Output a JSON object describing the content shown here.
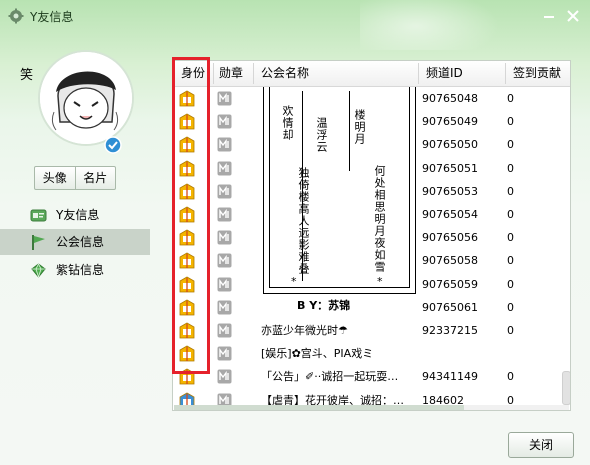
{
  "window": {
    "title": "Y友信息"
  },
  "profile": {
    "avatar_label": "笑",
    "buttons": [
      "头像",
      "名片"
    ]
  },
  "sidebar": {
    "items": [
      {
        "label": "Y友信息",
        "icon": "id-card-icon"
      },
      {
        "label": "公会信息",
        "icon": "flag-icon",
        "active": true
      },
      {
        "label": "紫钻信息",
        "icon": "diamond-icon"
      }
    ]
  },
  "table": {
    "columns": [
      "身份",
      "勋章",
      "公会名称",
      "频道ID",
      "签到贡献"
    ],
    "rows": [
      {
        "channel_id": "90765048",
        "contribution": "0"
      },
      {
        "channel_id": "90765049",
        "contribution": "0"
      },
      {
        "channel_id": "90765050",
        "contribution": "0"
      },
      {
        "channel_id": "90765051",
        "contribution": "0"
      },
      {
        "channel_id": "90765053",
        "contribution": "0"
      },
      {
        "channel_id": "90765054",
        "contribution": "0"
      },
      {
        "channel_id": "90765056",
        "contribution": "0"
      },
      {
        "channel_id": "90765058",
        "contribution": "0"
      },
      {
        "channel_id": "90765059",
        "contribution": "0"
      },
      {
        "channel_id": "90765061",
        "contribution": "0"
      },
      {
        "name": "亦蓝少年微光时☂",
        "channel_id": "92337215",
        "contribution": "0"
      },
      {
        "name": "[娱乐]✿宫斗、PIA戏ミ",
        "channel_id": "",
        "contribution": ""
      },
      {
        "name": "「公告」✐··诚招一起玩耍…",
        "channel_id": "94341149",
        "contribution": "0"
      },
      {
        "name": "【虐青】花开彼岸、诚招：…",
        "channel_id": "184602",
        "contribution": "0"
      }
    ]
  },
  "guild_art": {
    "cols": [
      "欢情却",
      "温浮云",
      "独倚楼高人远影难叠",
      "楼明月",
      "何处相思明月夜如雪"
    ],
    "signature": "B Y：苏锦",
    "stars": [
      "*",
      "*"
    ]
  },
  "footer": {
    "close_label": "关闭"
  },
  "colors": {
    "highlight": "#e5212b",
    "accent": "#3fa23f"
  }
}
